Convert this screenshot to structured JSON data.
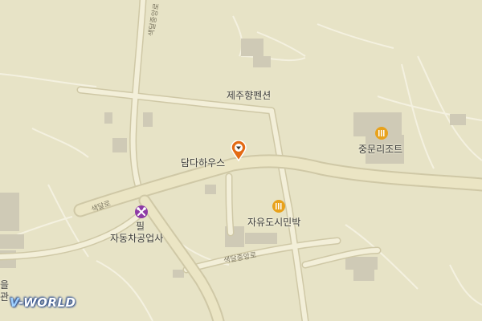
{
  "map": {
    "background_color": "#e7e3c6",
    "road_color": "#ebe6c9",
    "road_edge_color": "#cfc8a6",
    "building_color": "#c9c5b4"
  },
  "places": {
    "jeju_hyang_pension": "제주향펜션",
    "jungmun_resort": "중문리조트",
    "damda_house": "담다하우스",
    "jayu_dosi_minbak": "자유도시민박",
    "pil_line1": "필",
    "pil_line2": "자동차공업사",
    "cut_left_1": "을",
    "cut_left_2": "관"
  },
  "roads": {
    "saekdal_ro": "색달로",
    "saekdal_jungang_ro_south": "색달중앙로",
    "saekdal_jungang_ro_north": "색달중앙로"
  },
  "icons": {
    "selected_pin": "location-pin-icon",
    "lodging": "lodging-icon",
    "car_repair": "car-repair-icon"
  },
  "logo": {
    "prefix": "V",
    "text": "-WORLD"
  }
}
